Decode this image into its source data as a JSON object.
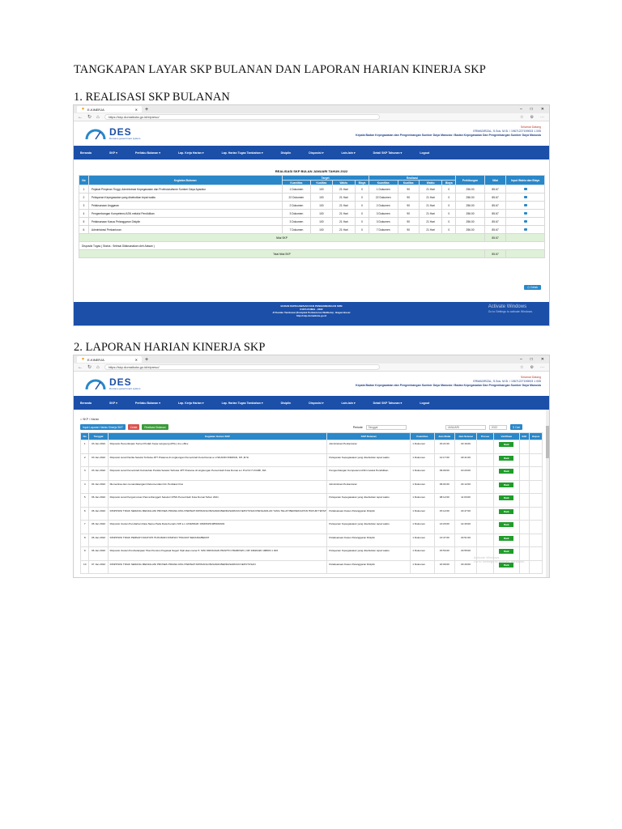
{
  "doc_title": "TANGKAPAN LAYAR SKP BULANAN DAN LAPORAN HARIAN KINERJA SKP",
  "section1_title": "1. REALISASI SKP BULANAN",
  "section2_title": "2. LAPORAN HARIAN KINERJA SKP",
  "browser": {
    "tab_label": "E-KINERJA",
    "url": "https://skp.dumaikota.go.id/eipreso/"
  },
  "app": {
    "logo": "DES",
    "logo_tagline": "Dumai e-government system",
    "greeting": "Selamat Datang",
    "user": "ERMADIRZAL, S.Sos. M.Si. / 19671227199003 1 005",
    "agency": "Kepala Badan Kepegawaian dan Pengembangan Sumber Daya Manusia / Badan Kepegawaian Dan Pengembangan Sumber Daya Manusia",
    "nav": [
      "Beranda",
      "SKP ▾",
      "Perilaku Bulanan ▾",
      "Lap. Kerja Harian ▾",
      "Lap. Harian Tugas Tambahan ▾",
      "Disiplin",
      "Disposisi ▾",
      "Lain-lain ▾",
      "Detail SKP Tahunan ▾",
      "Logout"
    ],
    "footer_lines": [
      "BADAN KEPEGAWAIAN DAN PENGEMBANGAN SDM",
      "KOTA DUMAI - 2022",
      "Jl.Tuanku Tambusai (Komplek Perkantoran Walikota) - Bagan Besar",
      "http://skp.dumaikota.go.id"
    ],
    "watermark_1": "Activate Windows",
    "watermark_2": "Go to Settings to activate Windows."
  },
  "report": {
    "title": "REALISASI SKP BULAN JANUARI TAHUN 2022",
    "headers": {
      "no": "No",
      "kegiatan": "Kegiatan Bulanan",
      "target": "Target",
      "realisasi": "Realisasi",
      "perhitungan": "Perhitungan",
      "nilai": "Nilai",
      "input": "Input Waktu dan Biaya",
      "sub": [
        "Kuantitas",
        "Kualitas",
        "Waktu",
        "Biaya",
        "Kuantitas",
        "Kualitas",
        "Waktu",
        "Biaya"
      ]
    },
    "rows": [
      [
        "1",
        "Pejabat Pimpinan Tinggi, Administrasi Kepegawaian dan Profesionalisme Sumber Daya Aparatur",
        "1 Dokumen",
        "100",
        "21 Hari",
        "0",
        "1 Dokumen",
        "90",
        "21 Hari",
        "0",
        "256.00",
        "85.67"
      ],
      [
        "2",
        "Pelayanan Kepegawaian yang disebutkan tepat waktu",
        "22 Dokumen",
        "100",
        "21 Hari",
        "0",
        "22 Dokumen",
        "90",
        "21 Hari",
        "0",
        "256.00",
        "85.67"
      ],
      [
        "3",
        "Pelaksanaan Anggaran",
        "2 Dokumen",
        "100",
        "21 Hari",
        "0",
        "2 Dokumen",
        "90",
        "21 Hari",
        "0",
        "256.00",
        "85.67"
      ],
      [
        "4",
        "Pengembangan Kompetensi ASN melalui Pendidikan",
        "3 Dokumen",
        "100",
        "21 Hari",
        "0",
        "3 Dokumen",
        "90",
        "21 Hari",
        "0",
        "256.00",
        "85.67"
      ],
      [
        "5",
        "Pelaksanaan Kasus Pelanggaran Disiplin",
        "3 Dokumen",
        "100",
        "21 Hari",
        "0",
        "3 Dokumen",
        "90",
        "21 Hari",
        "0",
        "256.00",
        "85.67"
      ],
      [
        "6",
        "Administrasi Perkantoran",
        "7 Dokumen",
        "100",
        "21 Hari",
        "0",
        "7 Dokumen",
        "90",
        "21 Hari",
        "0",
        "256.00",
        "85.67"
      ]
    ],
    "nilai_skp_label": "Nilai SKP",
    "nilai_skp": "85.67",
    "disposisi_label": "Disposisi Tugas ( Status : Selesai Dilaksanakan oleh Atasan )",
    "total_label": "Total Nilai SKP",
    "total": "85.67",
    "cetak": "Cetak"
  },
  "harian": {
    "breadcrumb": "⌂ SKP / Harian",
    "buttons": [
      "Input Laporan Harian Kinerja SKP",
      "Cetak",
      "Realisasi Bulanan"
    ],
    "periode_label": "Periode",
    "tanggal_placeholder": "Tanggal",
    "bulan": "JANUARI",
    "tahun": "2022",
    "cari": "Cari",
    "headers": [
      "No",
      "Tanggal",
      "Kegiatan Harian SKP",
      "SKP Bulanan",
      "Kuantitas",
      "Jam Mulai",
      "Jam Selesai",
      "Proses",
      "Verifikasi",
      "Edit",
      "Hapus"
    ],
    "rows": [
      [
        "1",
        "03 Jan 2022",
        "Disposisi Pemeriksaan Survei Pindah Kerja Langsung (PKL) di e-office",
        "Administrasi Perkantoran",
        "1 Dokumen",
        "15:21:00",
        "16:16:00",
        "Baik"
      ],
      [
        "2",
        "03 Jan 2022",
        "Disposisi surat Panitia Seleksi Terbuka JPT Pratama di Lingkungan Pemerintah Kota Dumai a.n ISKANDI RIDWAN, SH.,M.Si",
        "Pelayanan Kepegawaian yang disebutkan tepat waktu",
        "1 Dokumen",
        "12:17:00",
        "18:41:00",
        "Baik"
      ],
      [
        "3",
        "03 Jan 2022",
        "Disposisi surat Pemerintah Kebutuhan Panitia Seleksi Terbuka JPT Pratama di Lingkungan Pemerintah Kota Dumai a.n Prof Dr H AYABI, MA",
        "Pengembangan Kompetensi ASN melalui Pendidikan",
        "1 Dokumen",
        "09:09:00",
        "10:20:00",
        "Baik"
      ],
      [
        "4",
        "04 Jan 2022",
        "Memeriksa dan menandatangani Rekomendasi Izin Penilaian Dus",
        "Administrasi Perkantoran",
        "1 Dokumen",
        "09:04:00",
        "16:12:00",
        "Baik"
      ],
      [
        "5",
        "06 Jan 2022",
        "Disposisi surat Pengumuman Panca Ranggeh Seleksi CPNS Pemerintah Kota Dumai Tahun 2021",
        "Pelayanan Kepegawaian yang disebutkan tepat waktu",
        "1 Dokumen",
        "08:12:00",
        "11:03:00",
        "Baik"
      ],
      [
        "6",
        "06 Jan 2022",
        "DISPOSISI TIDAK SEDANG MENJALANI PROSES PIDANA ATAU PERNAH DIPIDANA PENJARA BERDASARKAN KEPUTUSAN PENGADILAN YANG TELAH BERKEKUATAN HUKUM TETAP",
        "Pelaksanaan Kasus Pelanggaran Disiplin",
        "1 Dokumen",
        "15:12:00",
        "16:47:00",
        "Baik"
      ],
      [
        "7",
        "06 Jan 2022",
        "Disposisi Usulan Perubahan Data Nama Pada Data Kenaris NIP a.n JASMIDAR 196306151985032004",
        "Pelayanan Kepegawaian yang disebutkan tepat waktu",
        "1 Dokumen",
        "13:20:00",
        "14:30:00",
        "Baik"
      ],
      [
        "8",
        "06 Jan 2022",
        "DISPOSISI TIDAK PERNAH DIJATUHI HUKUMAN DISIPLIN TINGKAT SEDANG/BERAT",
        "Pelaksanaan Kasus Pelanggaran Disiplin",
        "1 Dokumen",
        "13:47:00",
        "16:51:00",
        "Baik"
      ],
      [
        "9",
        "06 Jan 2022",
        "Disposisi Usulan Pembelanjaan Tiket Pensiun Pegawai Negeri Sipil atas nama H. SWI ORDIGSAN PRAPTO PRABOWO, NIP 19620420 198803 1 003",
        "Pelayanan Kepegawaian yang disebutkan tepat waktu",
        "1 Dokumen",
        "15:53:00",
        "16:55:00",
        "Baik"
      ],
      [
        "10",
        "07 Jan 2022",
        "DISPOSISI TIDAK SEDANG MENJALANI PROSES PIDANA ATAU PERNAH DIPIDANA PENJARA BERDASARKAN KEPUTUSAN",
        "Pelaksanaan Kasus Pelanggaran Disiplin",
        "1 Dokumen",
        "16:09:00",
        "16:40:00",
        "Baik"
      ]
    ]
  }
}
